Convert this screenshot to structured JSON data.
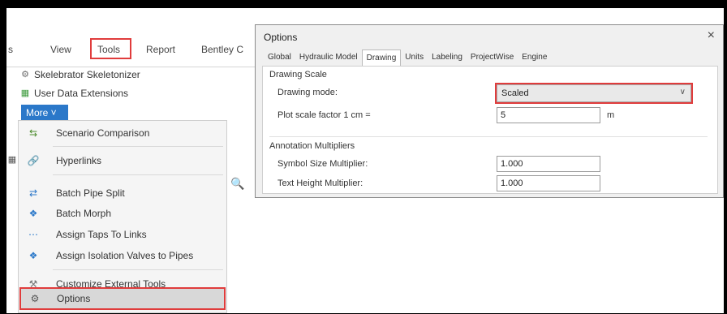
{
  "ribbon": {
    "tabs": [
      {
        "label": "s"
      },
      {
        "label": "View"
      },
      {
        "label": "Tools"
      },
      {
        "label": "Report"
      },
      {
        "label": "Bentley C"
      }
    ],
    "group_items": [
      {
        "label": "Skelebrator Skeletonizer",
        "icon": "skeleton-icon"
      },
      {
        "label": "User Data Extensions",
        "icon": "user-data-icon"
      }
    ],
    "more_label": "More ˅"
  },
  "menu": {
    "items": [
      {
        "label": "Scenario Comparison",
        "icon": "scenario-compare-icon"
      },
      {
        "label": "Hyperlinks",
        "icon": "hyperlink-icon"
      },
      {
        "label": "Batch Pipe Split",
        "icon": "pipe-split-icon"
      },
      {
        "label": "Batch Morph",
        "icon": "morph-icon"
      },
      {
        "label": "Assign Taps To Links",
        "icon": "tap-icon"
      },
      {
        "label": "Assign Isolation Valves to Pipes",
        "icon": "valve-icon"
      },
      {
        "label": "Customize External Tools",
        "icon": "tools-icon"
      },
      {
        "label": "Options",
        "icon": "options-icon"
      }
    ]
  },
  "dialog": {
    "title": "Options",
    "close": "×",
    "tabs": [
      "Global",
      "Hydraulic Model",
      "Drawing",
      "Units",
      "Labeling",
      "ProjectWise",
      "Engine"
    ],
    "active_tab": "Drawing",
    "drawing_scale": {
      "section": "Drawing Scale",
      "mode_label": "Drawing mode:",
      "mode_value": "Scaled",
      "plot_label": "Plot scale factor  1 cm =",
      "plot_value": "5",
      "plot_unit": "m"
    },
    "annotation": {
      "section": "Annotation Multipliers",
      "symbol_label": "Symbol Size Multiplier:",
      "symbol_value": "1.000",
      "text_label": "Text Height Multiplier:",
      "text_value": "1.000"
    }
  },
  "colors": {
    "highlight": "#e03c3c",
    "more_button": "#2b78c9"
  }
}
